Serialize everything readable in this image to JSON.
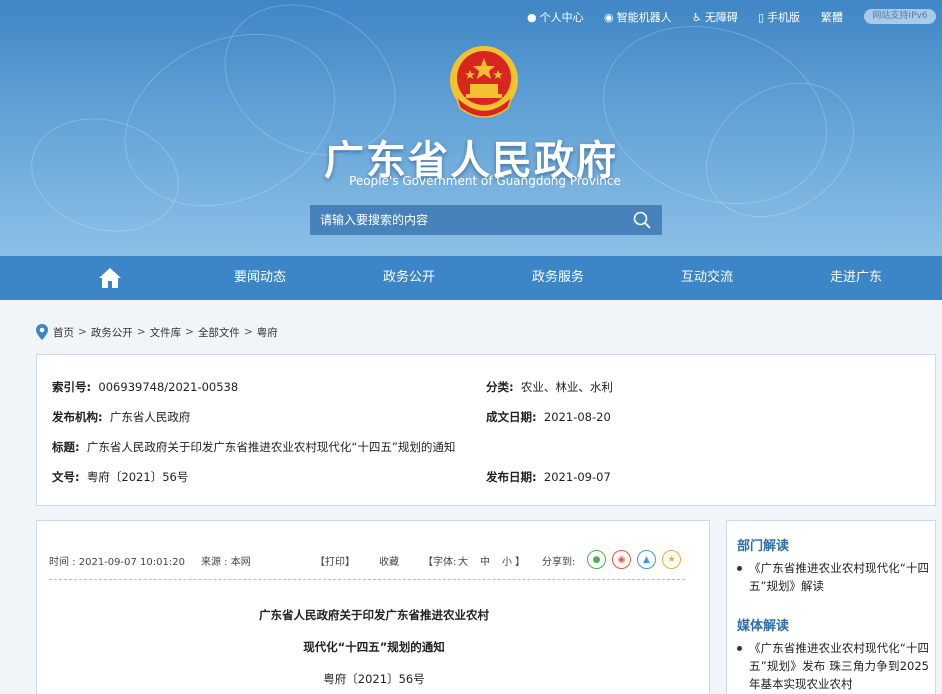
{
  "topbar": {
    "items": [
      {
        "icon": "user-icon",
        "label": "个人中心"
      },
      {
        "icon": "robot-icon",
        "label": "智能机器人"
      },
      {
        "icon": "accessibility-icon",
        "label": "无障碍"
      },
      {
        "icon": "mobile-icon",
        "label": "手机版"
      },
      {
        "label": "繁體"
      }
    ],
    "ipv6_badge": "网站支持IPv6"
  },
  "header": {
    "title": "广东省人民政府",
    "subtitle": "People's Government of Guangdong Province"
  },
  "search": {
    "placeholder": "请输入要搜索的内容"
  },
  "nav": {
    "items": [
      "要闻动态",
      "政务公开",
      "政务服务",
      "互动交流",
      "走进广东"
    ]
  },
  "breadcrumb": [
    "首页",
    "政务公开",
    "文件库",
    "全部文件",
    "粤府"
  ],
  "info": {
    "index_label": "索引号:",
    "index_value": "006939748/2021-00538",
    "category_label": "分类:",
    "category_value": "农业、林业、水利",
    "issuer_label": "发布机构:",
    "issuer_value": "广东省人民政府",
    "created_label": "成文日期:",
    "created_value": "2021-08-20",
    "title_label": "标题:",
    "title_value": "广东省人民政府关于印发广东省推进农业农村现代化“十四五”规划的通知",
    "docno_label": "文号:",
    "docno_value": "粤府〔2021〕56号",
    "pubdate_label": "发布日期:",
    "pubdate_value": "2021-09-07"
  },
  "article": {
    "time": "时间 : 2021-09-07 10:01:20",
    "source": "来源 : 本网",
    "print": "【打印】",
    "favorite": "收藏",
    "font_label": "【字体:",
    "font_large": "大",
    "font_medium": "中",
    "font_small": "小",
    "font_close": "】",
    "share_label": "分享到:",
    "title_line1": "广东省人民政府关于印发广东省推进农业农村",
    "title_line2": "现代化“十四五”规划的通知",
    "doc_number": "粤府〔2021〕56号"
  },
  "sidebar": {
    "dept_heading": "部门解读",
    "dept_item": "《广东省推进农业农村现代化“十四五”规划》解读",
    "media_heading": "媒体解读",
    "media_item": "《广东省推进农业农村现代化“十四五”规划》发布 珠三角力争到2025年基本实现农业农村"
  },
  "colors": {
    "nav_bg": "#3c86c7",
    "heading_blue": "#2f6fae",
    "emblem_red": "#d7261f",
    "emblem_gold": "#f2c230"
  }
}
